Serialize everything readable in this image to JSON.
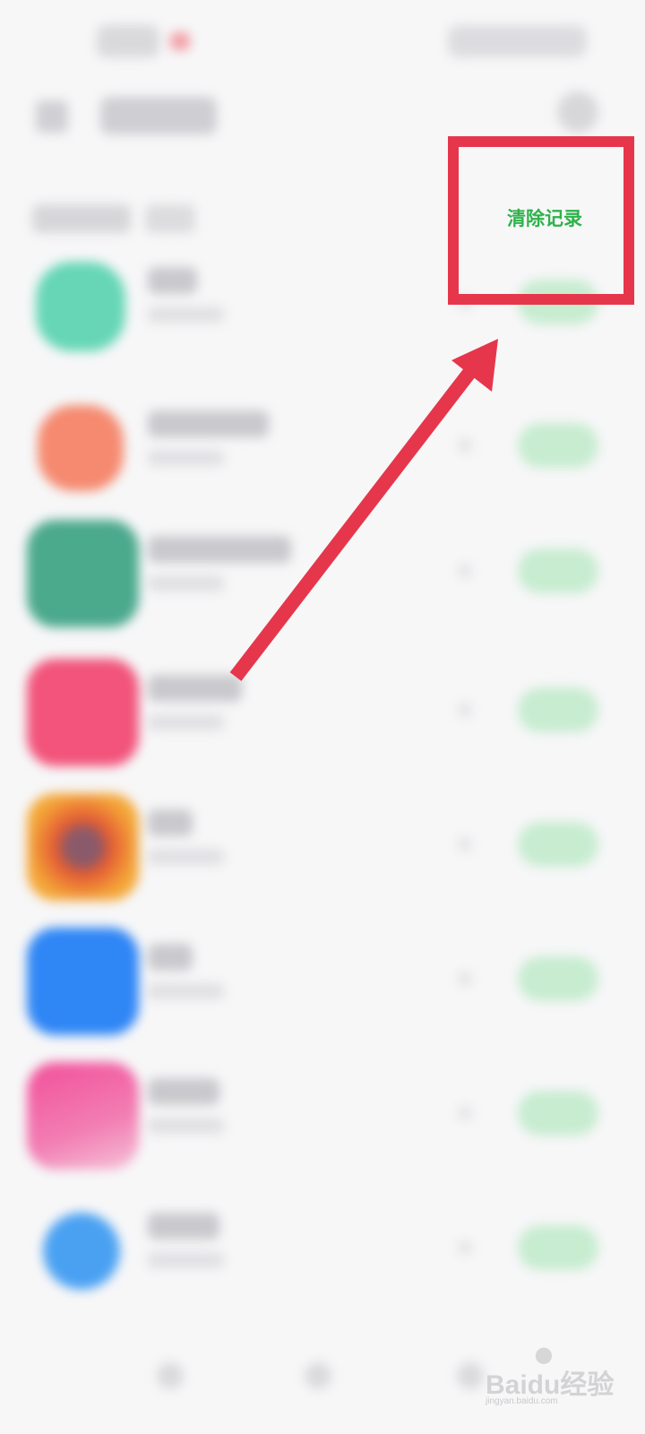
{
  "header": {
    "clear_records_label": "清除记录"
  },
  "apps": [
    {
      "icon_color": "#66d6b6"
    },
    {
      "icon_color": "#f58a70"
    },
    {
      "icon_color": "#4ba98c"
    },
    {
      "icon_color": "#f2547b"
    },
    {
      "icon_color": "#f4a838"
    },
    {
      "icon_color": "#2f86f5"
    },
    {
      "icon_color": "#f24f9a"
    },
    {
      "icon_color": "#4aa1f2"
    }
  ],
  "colors": {
    "accent_green": "#2fb24a",
    "highlight_red": "#e6364b"
  },
  "icons": {
    "annotation_arrow": "arrow-up-right-icon"
  },
  "watermark": {
    "brand": "Baidu经验",
    "domain": "jingyan.baidu.com"
  }
}
